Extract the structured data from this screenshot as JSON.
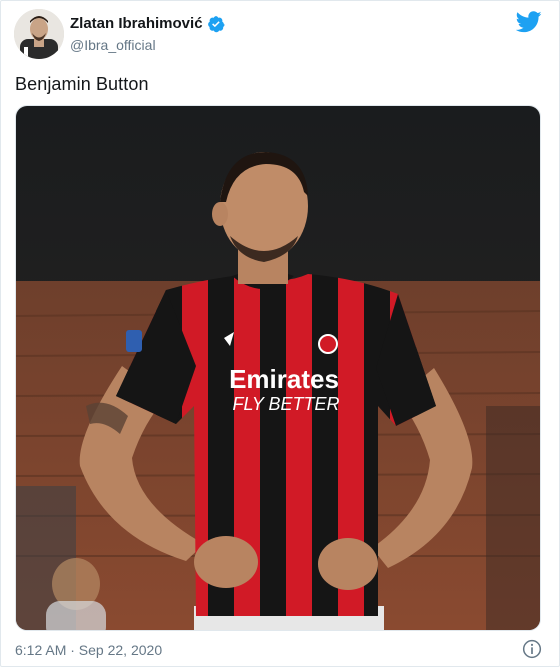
{
  "tweet": {
    "author_name": "Zlatan Ibrahimović",
    "author_handle": "@Ibra_official",
    "text": "Benjamin Button",
    "timestamp": "6:12 AM · Sep 22, 2020",
    "photo_jersey_sponsor": "Emirates",
    "photo_jersey_slogan": "FLY BETTER"
  },
  "icons": {
    "verified": "verified-badge-icon",
    "platform": "twitter-bird-icon",
    "info": "info-icon"
  },
  "colors": {
    "twitter_blue": "#1da1f2",
    "name": "#14171a",
    "secondary_text": "#657786",
    "jersey_red": "#d11a26",
    "jersey_black": "#111111"
  }
}
